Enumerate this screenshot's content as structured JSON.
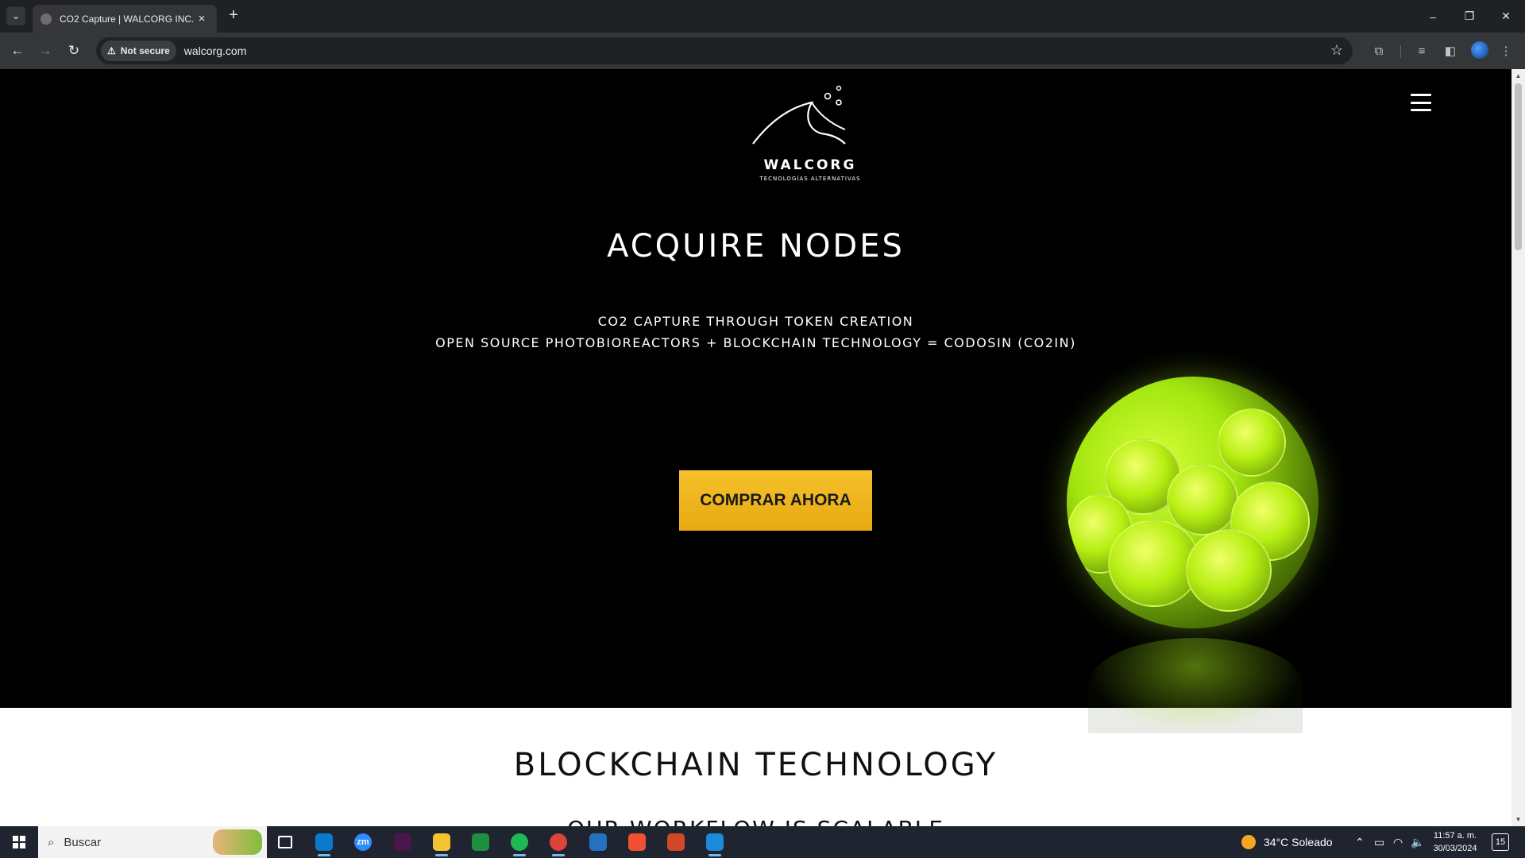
{
  "browser": {
    "tab_title": "CO2 Capture | WALCORG INC.",
    "security_label": "Not secure",
    "url": "walcorg.com"
  },
  "hero": {
    "logo_name": "WALCORG",
    "logo_tagline": "TECNOLOGÍAS ALTERNATIVAS",
    "title": "Acquire Nodes",
    "line1": "CO2 CAPTURE THROUGH TOKEN CREATION",
    "line2": "OPEN SOURCE PHOTOBIOREACTORS + BLOCKCHAIN TECHNOLOGY = CODOSIN (CO2IN)",
    "cta_label": "COMPRAR AHORA",
    "cta_color": "#f1b81f"
  },
  "section": {
    "title": "Blockchain Technology",
    "subtitle": "OUR WORKFLOW IS SCALABLE"
  },
  "taskbar": {
    "search_label": "Buscar",
    "apps": [
      {
        "name": "task-view",
        "label": "",
        "color": "#1f2430"
      },
      {
        "name": "vscode",
        "label": "",
        "color": "#0a7acc"
      },
      {
        "name": "zoom",
        "label": "zm",
        "color": "#2d8cff"
      },
      {
        "name": "slack",
        "label": "",
        "color": "#4a154b"
      },
      {
        "name": "file-explorer",
        "label": "",
        "color": "#f4c430"
      },
      {
        "name": "stocks",
        "label": "",
        "color": "#1e8f3e"
      },
      {
        "name": "spotify",
        "label": "",
        "color": "#1db954"
      },
      {
        "name": "chrome",
        "label": "",
        "color": "#db4437"
      },
      {
        "name": "powershell",
        "label": "",
        "color": "#2671be"
      },
      {
        "name": "git",
        "label": "",
        "color": "#f05133"
      },
      {
        "name": "powerpoint",
        "label": "",
        "color": "#d24726"
      },
      {
        "name": "paint",
        "label": "",
        "color": "#1b8adb"
      }
    ],
    "weather": "34°C  Soleado",
    "time": "11:57 a. m.",
    "date": "30/03/2024",
    "notifications": "15"
  }
}
